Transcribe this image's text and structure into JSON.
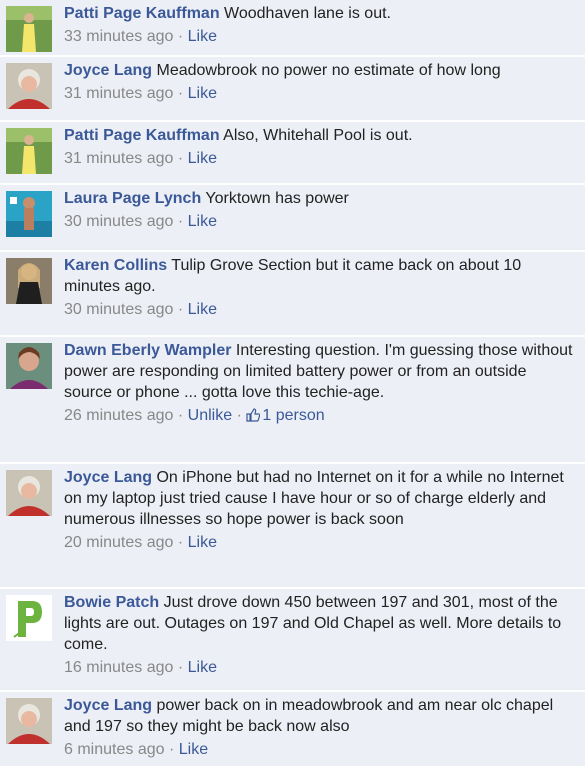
{
  "comments": [
    {
      "id": "c1",
      "author": "Patti Page Kauffman",
      "text": "Woodhaven lane is out.",
      "time": "33 minutes ago",
      "action": "Like",
      "avatar": "patti-avatar",
      "height": 57
    },
    {
      "id": "c2",
      "author": "Joyce Lang",
      "text": "Meadowbrook no power no estimate of how long",
      "time": "31 minutes ago",
      "action": "Like",
      "avatar": "joyce-avatar",
      "height": 65
    },
    {
      "id": "c3",
      "author": "Patti Page Kauffman",
      "text": "Also, Whitehall Pool is out.",
      "time": "31 minutes ago",
      "action": "Like",
      "avatar": "patti-avatar",
      "height": 63
    },
    {
      "id": "c4",
      "author": "Laura Page Lynch",
      "text": "Yorktown has power",
      "time": "30 minutes ago",
      "action": "Like",
      "avatar": "laura-avatar",
      "height": 67
    },
    {
      "id": "c5",
      "author": "Karen Collins",
      "text": "Tulip Grove Section but it came back on about 10 minutes ago.",
      "time": "30 minutes ago",
      "action": "Like",
      "avatar": "karen-avatar",
      "height": 85
    },
    {
      "id": "c6",
      "author": "Dawn Eberly Wampler",
      "text": "Interesting question. I'm guessing those without power are responding on limited battery power or from an outside source or phone ... gotta love this techie-age.",
      "time": "26 minutes ago",
      "action": "Unlike",
      "likes": "1 person",
      "avatar": "dawn-avatar",
      "height": 127
    },
    {
      "id": "c7",
      "author": "Joyce Lang",
      "text": "On iPhone but had no Internet on it for a while no Internet on my laptop just tried cause I have hour or so of charge elderly and numerous illnesses so hope power is back soon",
      "time": "20 minutes ago",
      "action": "Like",
      "avatar": "joyce-avatar",
      "height": 125
    },
    {
      "id": "c8",
      "author": "Bowie Patch",
      "text": "Just drove down 450 between 197 and 301, most of the lights are out. Outages on 197 and Old Chapel as well. More details to come.",
      "time": "16 minutes ago",
      "action": "Like",
      "avatar": "bowie-patch-logo",
      "height": 103
    },
    {
      "id": "c9",
      "author": "Joyce Lang",
      "text": "power back on in meadowbrook and am near olc chapel and 197 so they might be back now also",
      "time": "6 minutes ago",
      "action": "Like",
      "avatar": "joyce-avatar",
      "height": 76
    }
  ],
  "colors": {
    "link": "#3b5998",
    "meta": "#888888",
    "row_bg": "#eceff5",
    "patch_green": "#6cb33f"
  }
}
